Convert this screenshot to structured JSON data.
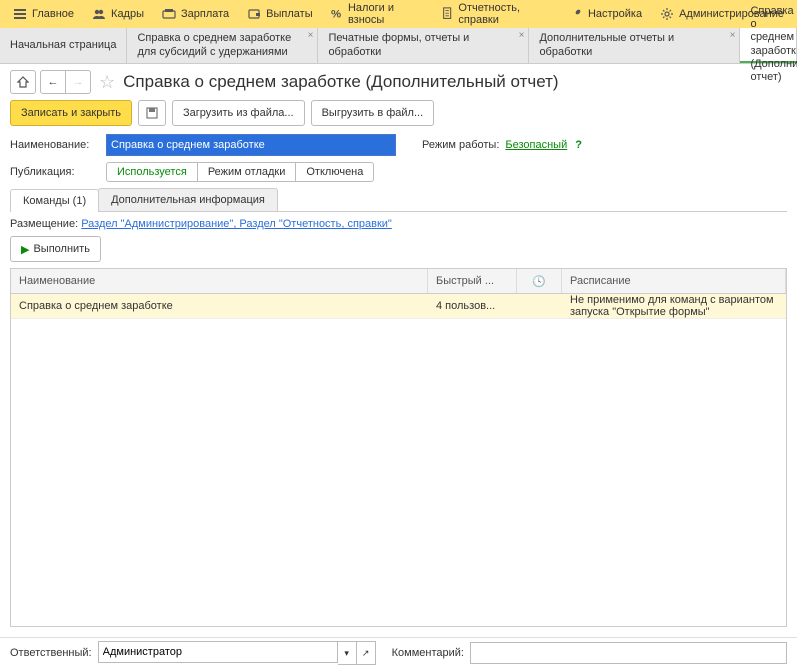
{
  "topmenu": {
    "main": "Главное",
    "personnel": "Кадры",
    "salary": "Зарплата",
    "payments": "Выплаты",
    "taxes": "Налоги и взносы",
    "reports": "Отчетность, справки",
    "settings": "Настройка",
    "admin": "Администрирование"
  },
  "tabs": {
    "start": "Начальная страница",
    "t1_l1": "Справка о среднем заработке",
    "t1_l2": "для субсидий с удержаниями",
    "t2": "Печатные формы, отчеты и обработки",
    "t3": "Дополнительные отчеты и обработки",
    "t4_l1": "Справка о среднем заработк",
    "t4_l2": "(Дополнительный отчет)"
  },
  "page": {
    "title": "Справка о среднем заработке (Дополнительный отчет)"
  },
  "toolbar": {
    "save_close": "Записать и закрыть",
    "load": "Загрузить из файла...",
    "save_to": "Выгрузить в файл..."
  },
  "form": {
    "name_label": "Наименование:",
    "name_value": "Справка о среднем заработке",
    "mode_label": "Режим работы:",
    "mode_value": "Безопасный",
    "pub_label": "Публикация:",
    "pub_used": "Используется",
    "pub_debug": "Режим отладки",
    "pub_off": "Отключена"
  },
  "subtabs": {
    "commands": "Команды (1)",
    "info": "Дополнительная информация"
  },
  "placement": {
    "label": "Размещение:",
    "link": "Раздел \"Администрирование\", Раздел \"Отчетность, справки\""
  },
  "exec_btn": "Выполнить",
  "grid": {
    "h_name": "Наименование",
    "h_quick": "Быстрый ...",
    "h_clock": "⏱",
    "h_sched": "Расписание",
    "r_name": "Справка о среднем заработке",
    "r_quick": "4 пользов...",
    "r_sched": "Не применимо для команд с вариантом запуска \"Открытие формы\""
  },
  "footer": {
    "resp_label": "Ответственный:",
    "resp_value": "Администратор",
    "comment_label": "Комментарий:"
  }
}
